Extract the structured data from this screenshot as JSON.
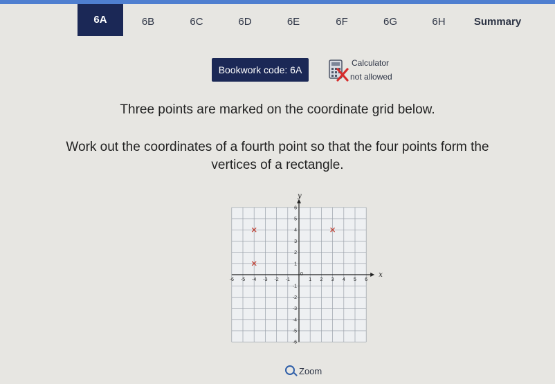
{
  "tabs": [
    "6A",
    "6B",
    "6C",
    "6D",
    "6E",
    "6F",
    "6G",
    "6H",
    "Summary"
  ],
  "active_tab": "6A",
  "bookwork": "Bookwork code: 6A",
  "calculator": {
    "line1": "Calculator",
    "line2": "not allowed",
    "icon": "calculator-crossed-icon"
  },
  "question": {
    "line1": "Three points are marked on the coordinate grid below.",
    "line2a": "Work out the coordinates of a fourth point so that the four points form the",
    "line2b": "vertices of a rectangle."
  },
  "grid": {
    "x_label": "x",
    "y_label": "y",
    "x_ticks": [
      "-6",
      "-5",
      "-4",
      "-3",
      "-2",
      "-1",
      "1",
      "2",
      "3",
      "4",
      "5",
      "6"
    ],
    "y_ticks": [
      "6",
      "5",
      "4",
      "3",
      "2",
      "1",
      "-1",
      "-2",
      "-3",
      "-4",
      "-5",
      "-6"
    ],
    "origin_label": "0",
    "xlim": [
      -6,
      6
    ],
    "ylim": [
      -6,
      6
    ],
    "points": [
      {
        "x": -4,
        "y": 4
      },
      {
        "x": 3,
        "y": 4
      },
      {
        "x": -4,
        "y": 1
      }
    ],
    "point_color": "#c0392b"
  },
  "zoom": {
    "label": "Zoom",
    "icon": "magnifier-icon"
  }
}
